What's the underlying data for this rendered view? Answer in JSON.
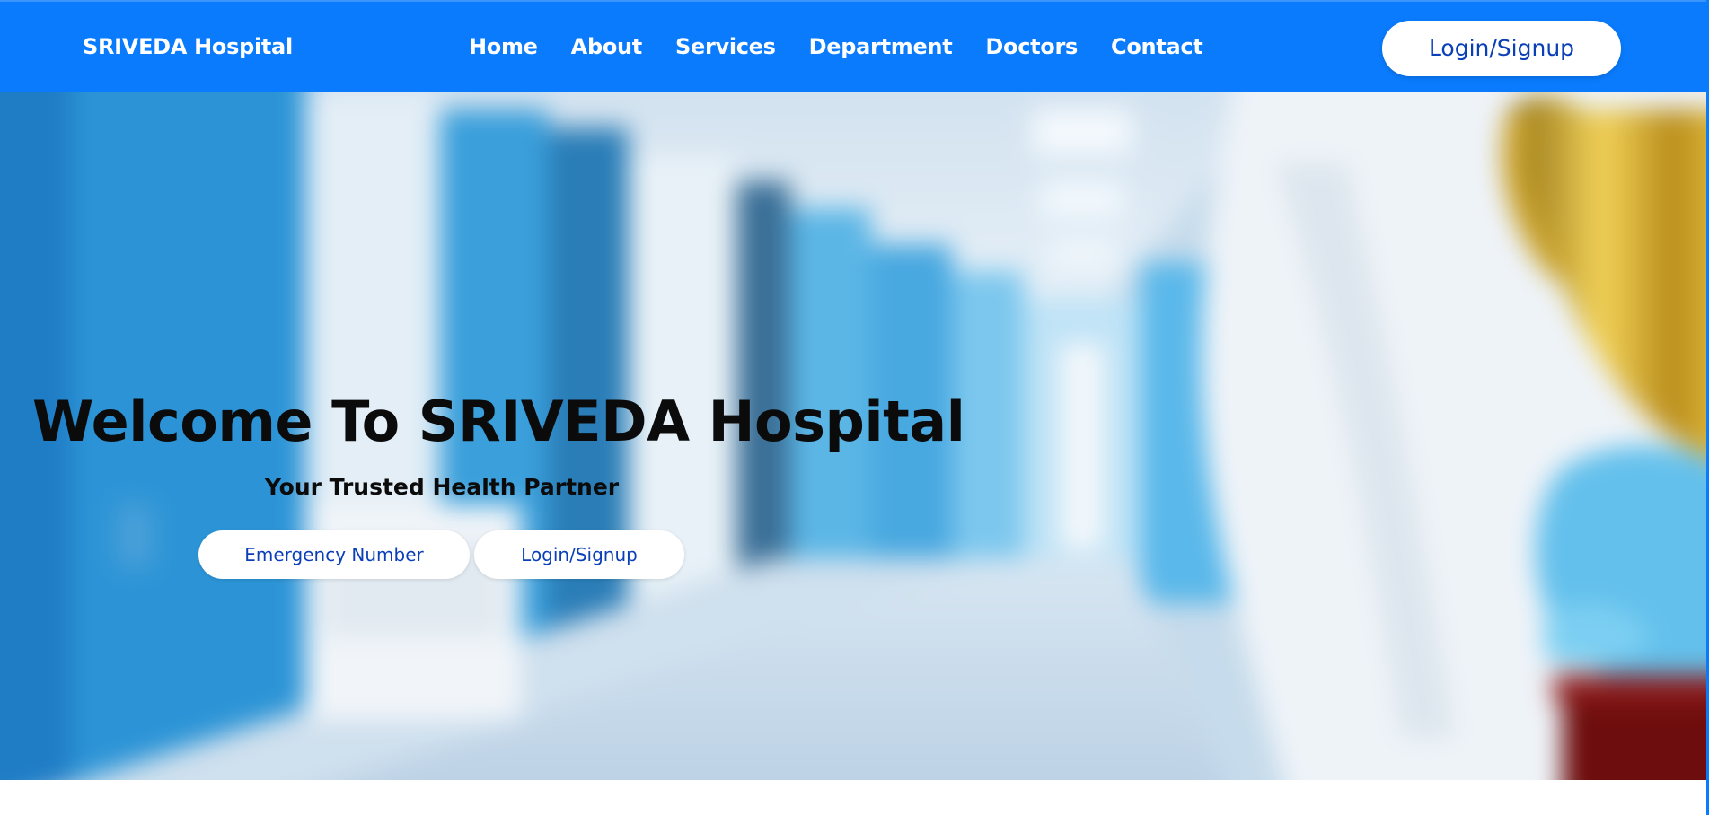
{
  "nav": {
    "brand": "SRIVEDA Hospital",
    "links": [
      "Home",
      "About",
      "Services",
      "Department",
      "Doctors",
      "Contact"
    ],
    "login_label": "Login/Signup"
  },
  "hero": {
    "title": "Welcome To SRIVEDA Hospital",
    "subtitle": "Your Trusted Health Partner",
    "emergency_label": "Emergency Number",
    "login_label": "Login/Signup"
  },
  "colors": {
    "navbar": "#0a7bfd",
    "button_text": "#0a3fb8",
    "hero_text": "#0b0b0b"
  }
}
